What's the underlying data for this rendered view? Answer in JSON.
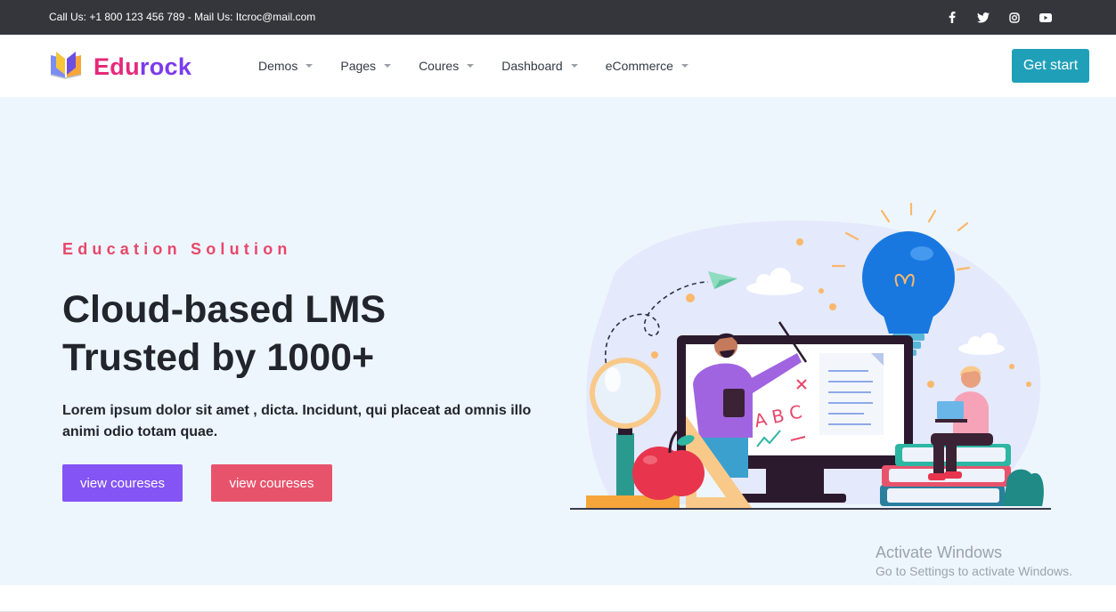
{
  "topbar": {
    "contact": "Call Us: +1 800 123 456 789 - Mail Us: Itcroc@mail.com",
    "social_icons": [
      "facebook-icon",
      "twitter-icon",
      "instagram-icon",
      "youtube-icon"
    ]
  },
  "header": {
    "logo": {
      "part1": "Edu",
      "part2": "rock",
      "icon": "open-book-icon"
    },
    "nav": [
      {
        "label": "Demos"
      },
      {
        "label": "Pages"
      },
      {
        "label": "Coures"
      },
      {
        "label": "Dashboard"
      },
      {
        "label": "eCommerce"
      }
    ],
    "cta_label": "Get start"
  },
  "hero": {
    "eyebrow": "Education Solution",
    "title_line1": "Cloud-based LMS",
    "title_line2": "Trusted by 1000+",
    "description": "Lorem ipsum dolor sit amet , dicta. Incidunt, qui placeat ad omnis illo animi odio totam quae.",
    "button_primary": "view coureses",
    "button_secondary": "view coureses",
    "illustration": {
      "board_letters": "A B C"
    }
  },
  "watermark": {
    "line1": "Activate Windows",
    "line2": "Go to Settings to activate Windows."
  },
  "colors": {
    "topbar_bg": "#34363c",
    "accent_teal": "#20a0b8",
    "accent_purple": "#8454f5",
    "accent_pink": "#e8536c",
    "hero_bg": "#eef6fd"
  }
}
